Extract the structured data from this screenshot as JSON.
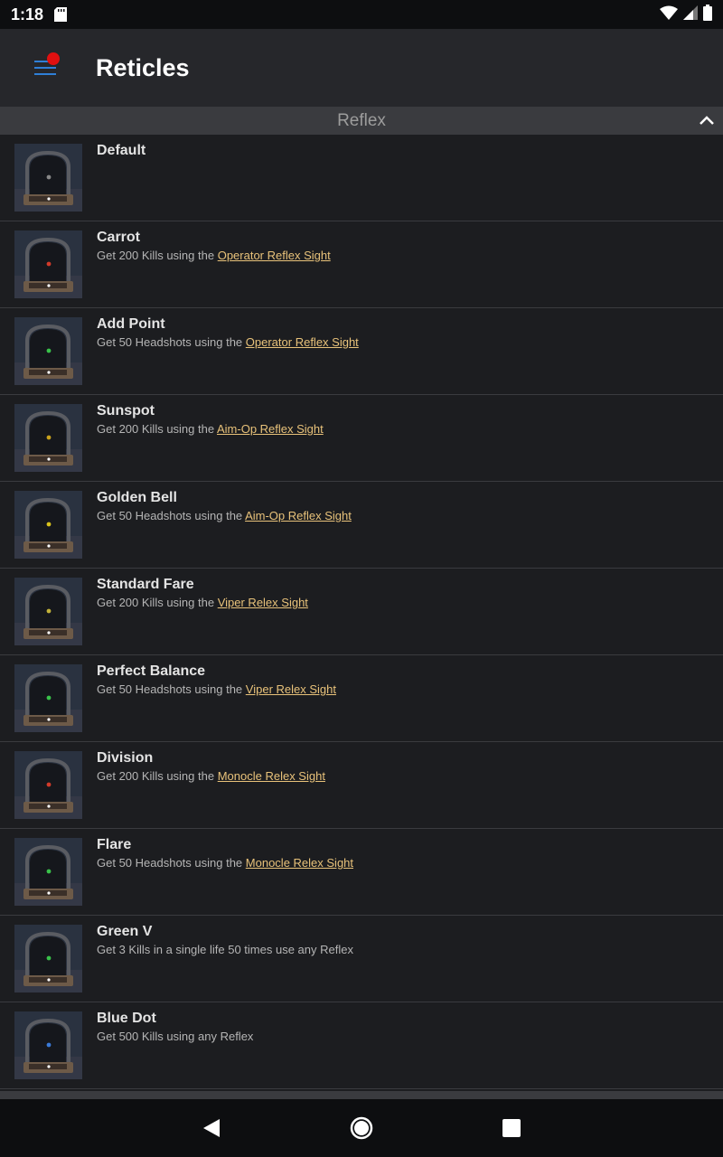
{
  "status": {
    "time": "1:18"
  },
  "header": {
    "title": "Reticles"
  },
  "section": {
    "title": "Reflex"
  },
  "items": [
    {
      "title": "Default",
      "desc": "",
      "link": "",
      "reticle_color": "#888888"
    },
    {
      "title": "Carrot",
      "desc": "Get 200 Kills using the ",
      "link": "Operator Reflex Sight",
      "reticle_color": "#d23a2a"
    },
    {
      "title": "Add Point",
      "desc": "Get 50 Headshots using the ",
      "link": "Operator Reflex Sight",
      "reticle_color": "#39c24a"
    },
    {
      "title": "Sunspot",
      "desc": "Get 200 Kills using the ",
      "link": "Aim-Op Reflex Sight",
      "reticle_color": "#c9a21c"
    },
    {
      "title": "Golden Bell",
      "desc": "Get 50 Headshots using the ",
      "link": "Aim-Op Reflex Sight",
      "reticle_color": "#d8c21c"
    },
    {
      "title": "Standard Fare",
      "desc": "Get 200 Kills using the ",
      "link": "Viper Relex Sight",
      "reticle_color": "#c2b23a"
    },
    {
      "title": "Perfect Balance",
      "desc": "Get 50 Headshots using the ",
      "link": "Viper Relex Sight",
      "reticle_color": "#39c24a"
    },
    {
      "title": "Division",
      "desc": "Get 200 Kills using the ",
      "link": "Monocle Relex Sight",
      "reticle_color": "#d23a2a"
    },
    {
      "title": "Flare",
      "desc": "Get 50 Headshots using the ",
      "link": "Monocle Relex Sight",
      "reticle_color": "#39c24a"
    },
    {
      "title": "Green V",
      "desc": "Get 3 Kills in a single life 50 times use any Reflex",
      "link": "",
      "reticle_color": "#39c24a"
    },
    {
      "title": "Blue Dot",
      "desc": "Get 500 Kills using any Reflex",
      "link": "",
      "reticle_color": "#3a7ad8"
    }
  ],
  "colors": {
    "accent": "#2f7fd8",
    "notification": "#e01010",
    "link": "#e8c27a"
  },
  "icons": {
    "menu": "hamburger-icon",
    "collapse": "chevron-up-icon",
    "back": "back-triangle-icon",
    "home": "home-circle-icon",
    "recents": "recents-square-icon"
  }
}
